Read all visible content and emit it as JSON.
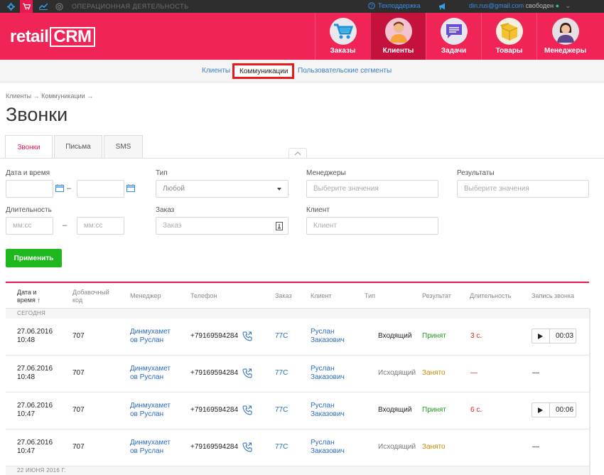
{
  "topbar": {
    "section_title": "ОПЕРАЦИОННАЯ ДЕЯТЕЛЬНОСТЬ",
    "support": "Техподдержка",
    "user_email": "din.rus@gmail.com",
    "user_status": "свободен",
    "icons": [
      "gear-icon",
      "cart-icon",
      "chart-icon",
      "target-icon",
      "megaphone-icon"
    ]
  },
  "header": {
    "logo_text": "retail",
    "logo_box": "CRM",
    "nav": [
      {
        "label": "Заказы",
        "icon": "cart-icon",
        "color": "#3aaee0"
      },
      {
        "label": "Клиенты",
        "icon": "person-icon",
        "color": "#f7a23b"
      },
      {
        "label": "Задачи",
        "icon": "chat-icon",
        "color": "#6a4fcf"
      },
      {
        "label": "Товары",
        "icon": "box-icon",
        "color": "#f2c232"
      },
      {
        "label": "Менеджеры",
        "icon": "manager-icon",
        "color": "#c9a48a"
      }
    ]
  },
  "subnav": {
    "items": [
      "Клиенты",
      "Коммуникации",
      "Пользовательские сегменты"
    ]
  },
  "breadcrumb": "Клиенты → Коммуникации →",
  "page_title": "Звонки",
  "tabs": [
    "Звонки",
    "Письма",
    "SMS"
  ],
  "filters": {
    "datetime_label": "Дата и время",
    "dash": "–",
    "type_label": "Тип",
    "type_value": "Любой",
    "managers_label": "Менеджеры",
    "managers_placeholder": "Выберите значения",
    "results_label": "Результаты",
    "results_placeholder": "Выберите значения",
    "duration_label": "Длительность",
    "duration_placeholder": "мм:сс",
    "order_label": "Заказ",
    "order_placeholder": "Заказ",
    "client_label": "Клиент",
    "client_placeholder": "Клиент",
    "apply": "Применить"
  },
  "table": {
    "headers": {
      "date_line1": "Дата и",
      "date_line2": "время ↑",
      "ext_line1": "Добавочный",
      "ext_line2": "код",
      "manager": "Менеджер",
      "phone": "Телефон",
      "order": "Заказ",
      "client": "Клиент",
      "type": "Тип",
      "result": "Результат",
      "duration": "Длительность",
      "record": "Запись звонка"
    },
    "group_today": "СЕГОДНЯ",
    "group_next": "22 ИЮНЯ 2016 Г.",
    "rows": [
      {
        "date": "27.06.2016",
        "time": "10:48",
        "ext": "707",
        "manager1": "Динмухамет",
        "manager2": "ов Руслан",
        "phone": "+79169594284",
        "order": "77C",
        "client1": "Руслан",
        "client2": "Заказович",
        "type": "Входящий",
        "result": "Принят",
        "duration": "3 с.",
        "record": "00:03"
      },
      {
        "date": "27.06.2016",
        "time": "10:48",
        "ext": "707",
        "manager1": "Динмухамет",
        "manager2": "ов Руслан",
        "phone": "+79169594284",
        "order": "77C",
        "client1": "Руслан",
        "client2": "Заказович",
        "type": "Исходящий",
        "result": "Занято",
        "duration": "—",
        "record": "—"
      },
      {
        "date": "27.06.2016",
        "time": "10:47",
        "ext": "707",
        "manager1": "Динмухамет",
        "manager2": "ов Руслан",
        "phone": "+79169594284",
        "order": "77C",
        "client1": "Руслан",
        "client2": "Заказович",
        "type": "Входящий",
        "result": "Принят",
        "duration": "6 с.",
        "record": "00:06"
      },
      {
        "date": "27.06.2016",
        "time": "10:47",
        "ext": "707",
        "manager1": "Динмухамет",
        "manager2": "ов Руслан",
        "phone": "+79169594284",
        "order": "77C",
        "client1": "Руслан",
        "client2": "Заказович",
        "type": "Исходящий",
        "result": "Занято",
        "duration": "",
        "record": "—"
      }
    ]
  }
}
